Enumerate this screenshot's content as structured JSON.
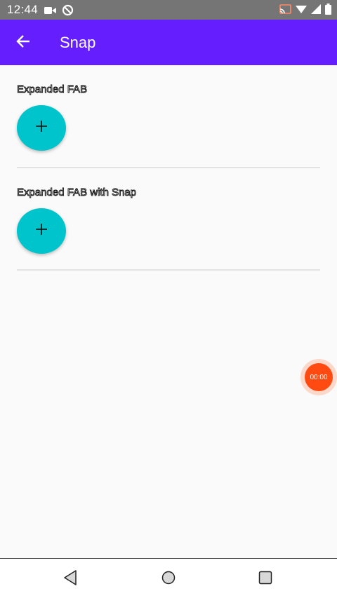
{
  "status_bar": {
    "time": "12:44",
    "left_icons": [
      "video-camera-icon",
      "no-sync-icon"
    ],
    "right_icons": [
      "cast-icon",
      "wifi-icon",
      "cell-signal-icon",
      "battery-icon"
    ]
  },
  "app_bar": {
    "title": "Snap",
    "back_icon": "arrow-back-icon",
    "color": "#651fff"
  },
  "sections": [
    {
      "title": "Expanded FAB",
      "fab_icon": "plus-icon"
    },
    {
      "title": "Expanded FAB with Snap",
      "fab_icon": "plus-icon"
    }
  ],
  "fab_color": "#00c4cc",
  "record_bubble": {
    "label": "00:00",
    "color": "#ff4a12"
  },
  "nav_bar": {
    "buttons": [
      "back",
      "home",
      "recents"
    ]
  }
}
